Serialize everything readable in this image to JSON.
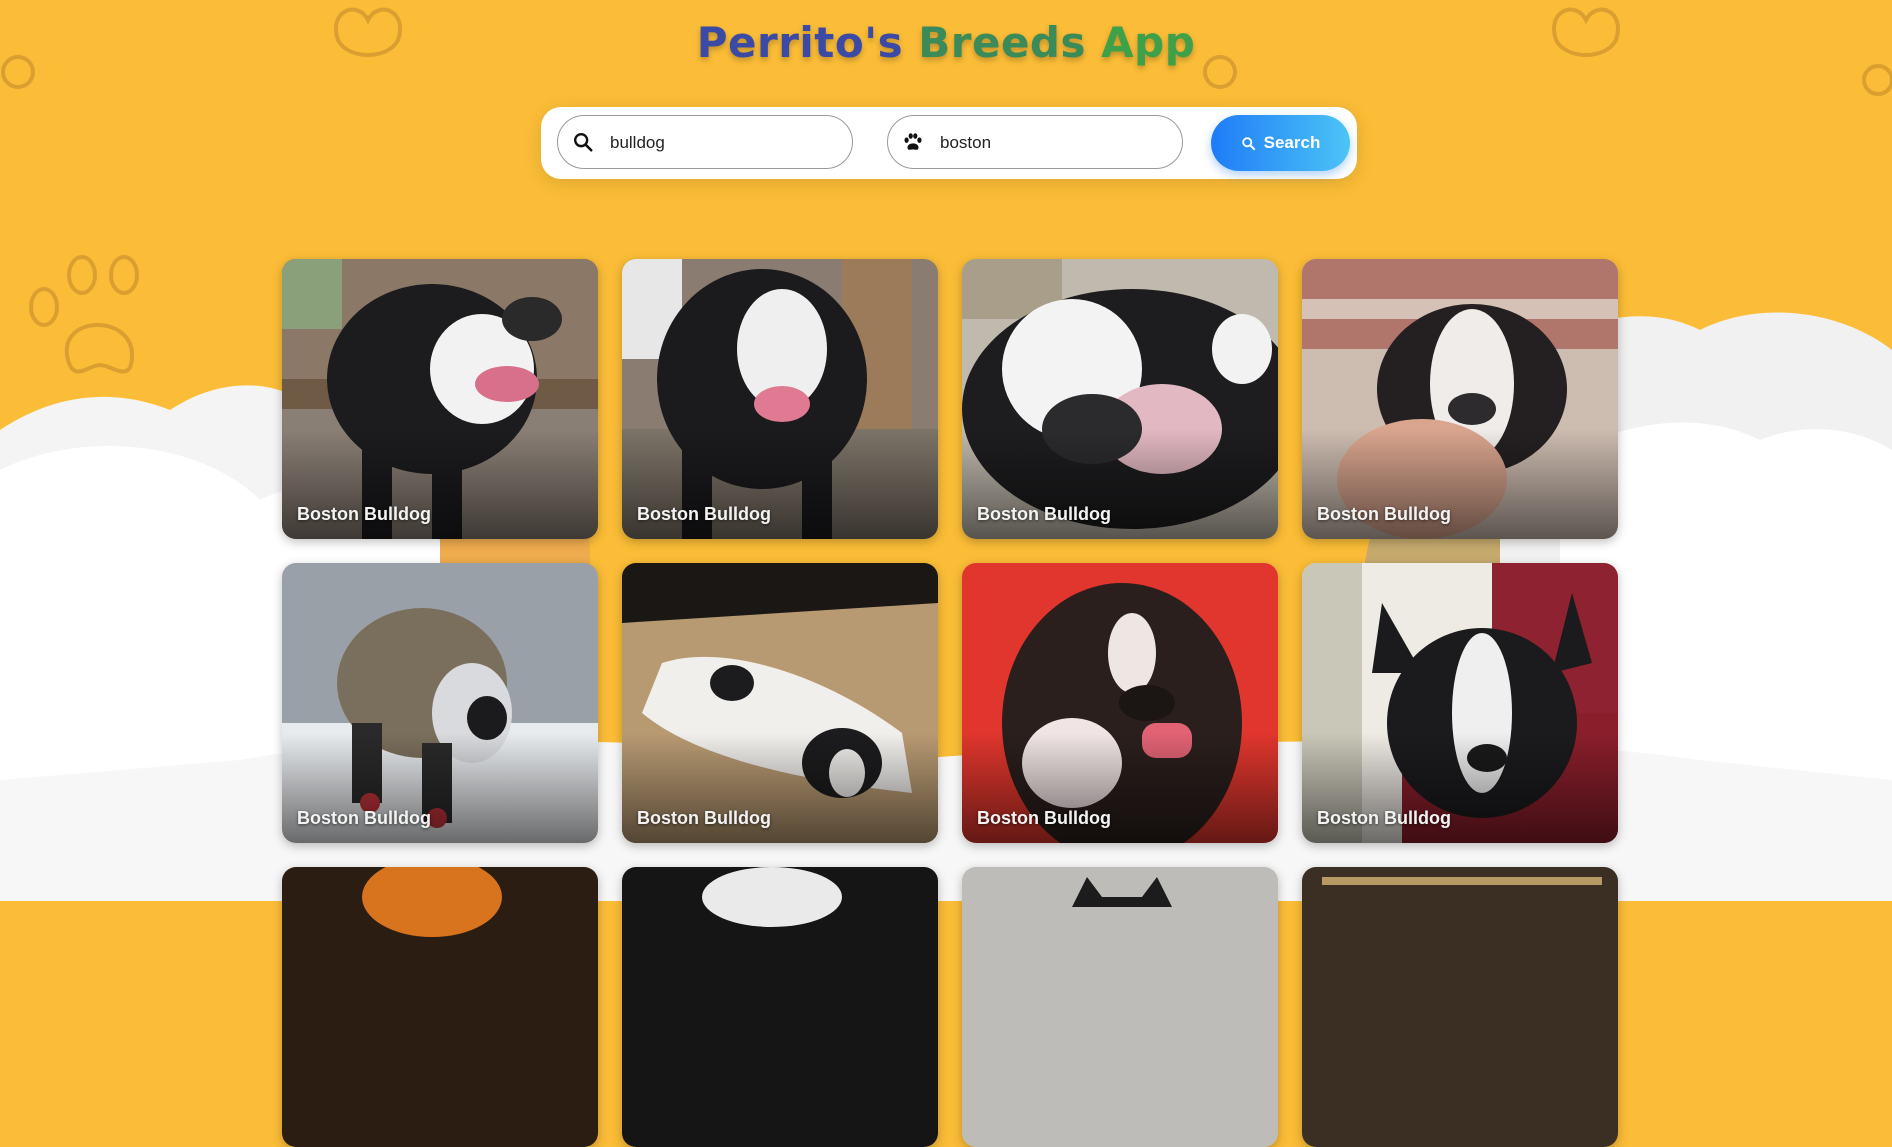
{
  "header": {
    "title_part1": "Perrito's",
    "title_part2": "Breeds",
    "title_part3": "App"
  },
  "search": {
    "breed_value": "bulldog",
    "sub_breed_value": "boston",
    "button_label": "Search",
    "breed_icon": "search-icon",
    "sub_breed_icon": "paw-icon"
  },
  "colors": {
    "background": "#fbbd37",
    "button_start": "#1e7cf7",
    "button_end": "#4cc4f6"
  },
  "cards": [
    {
      "label": "Boston Bulldog"
    },
    {
      "label": "Boston Bulldog"
    },
    {
      "label": "Boston Bulldog"
    },
    {
      "label": "Boston Bulldog"
    },
    {
      "label": "Boston Bulldog"
    },
    {
      "label": "Boston Bulldog"
    },
    {
      "label": "Boston Bulldog"
    },
    {
      "label": "Boston Bulldog"
    },
    {
      "label": ""
    },
    {
      "label": ""
    },
    {
      "label": ""
    },
    {
      "label": ""
    }
  ]
}
